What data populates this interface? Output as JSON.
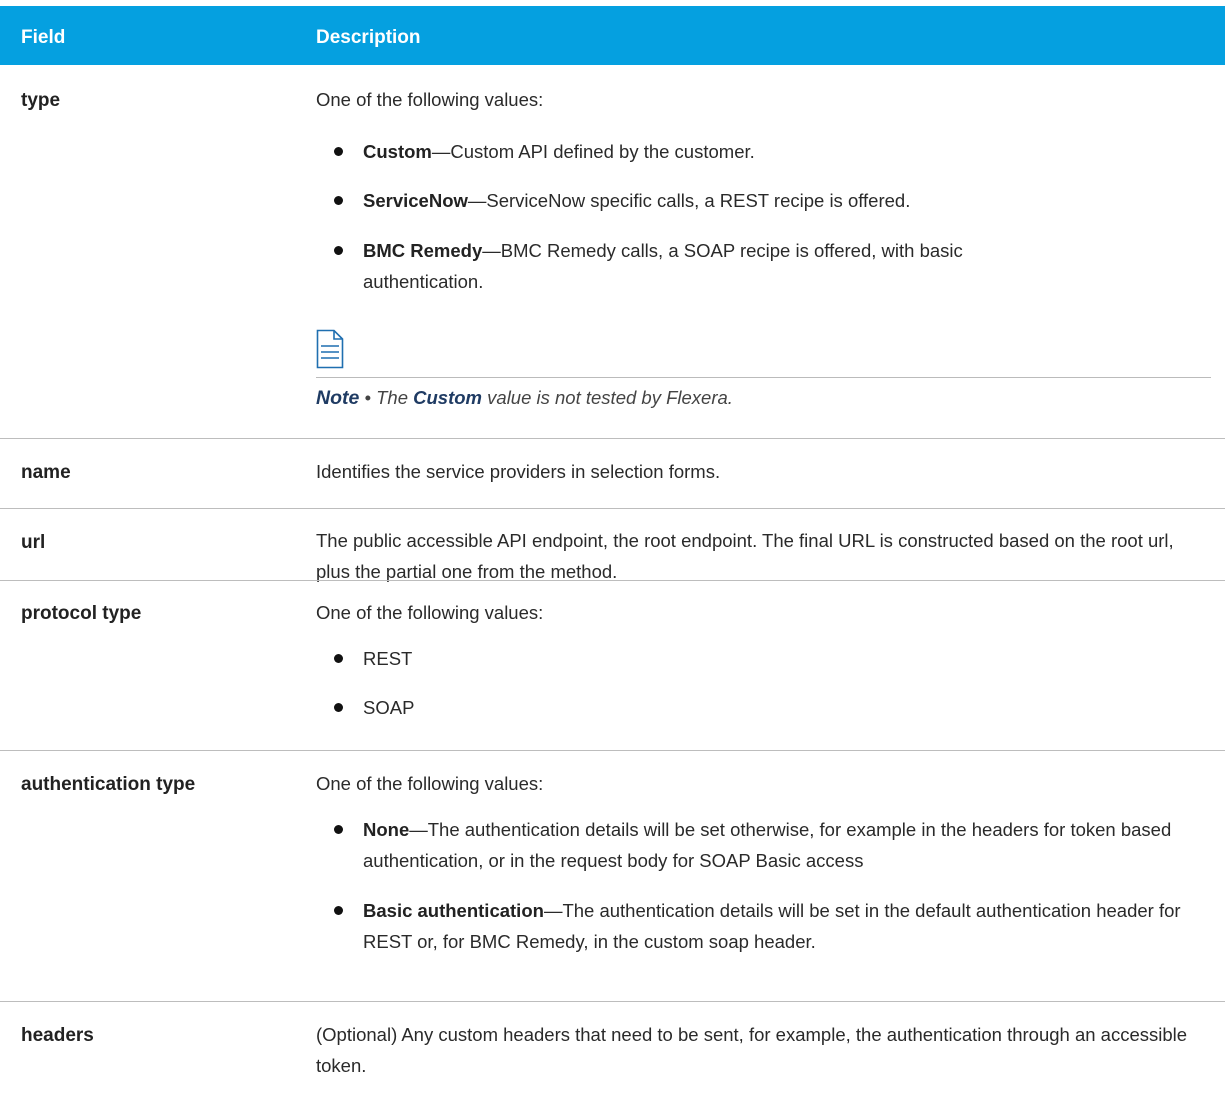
{
  "header": {
    "col1": "Field",
    "col2": "Description",
    "bg_color": "#05A0E0"
  },
  "rows": {
    "type": {
      "field": "type",
      "intro": "One of the following values:",
      "bullets": [
        {
          "term": "Custom",
          "text": "—Custom API defined by the customer."
        },
        {
          "term": "ServiceNow",
          "text": "—ServiceNow specific calls, a REST recipe is offered."
        },
        {
          "term": "BMC Remedy",
          "text": "—BMC Remedy calls, a SOAP recipe is offered, with basic authentication."
        }
      ],
      "note": {
        "icon": "note-document-icon",
        "label": "Note",
        "sep": " • ",
        "pre": "The ",
        "em": "Custom",
        "post": " value is not tested by Flexera."
      }
    },
    "name": {
      "field": "name",
      "text": "Identifies the service providers in selection forms."
    },
    "url": {
      "field": "url",
      "text": "The public accessible API endpoint, the root endpoint. The final URL is constructed based on the root url, plus the partial one from the method."
    },
    "protocol": {
      "field": "protocol type",
      "intro": "One of the following values:",
      "bullets": [
        "REST",
        "SOAP"
      ]
    },
    "auth": {
      "field": "authentication type",
      "intro": "One of the following values:",
      "bullets": [
        {
          "term": "None",
          "text": "—The authentication details will be set otherwise, for example in the headers for token based authentication, or in the request body for SOAP Basic access"
        },
        {
          "term": "Basic authentication",
          "text": "—The authentication details will be set in the default authentication header for REST or, for BMC Remedy, in the custom soap header."
        }
      ]
    },
    "headers": {
      "field": "headers",
      "text": "(Optional) Any custom headers that need to be sent, for example, the authentication through an accessible token."
    }
  }
}
